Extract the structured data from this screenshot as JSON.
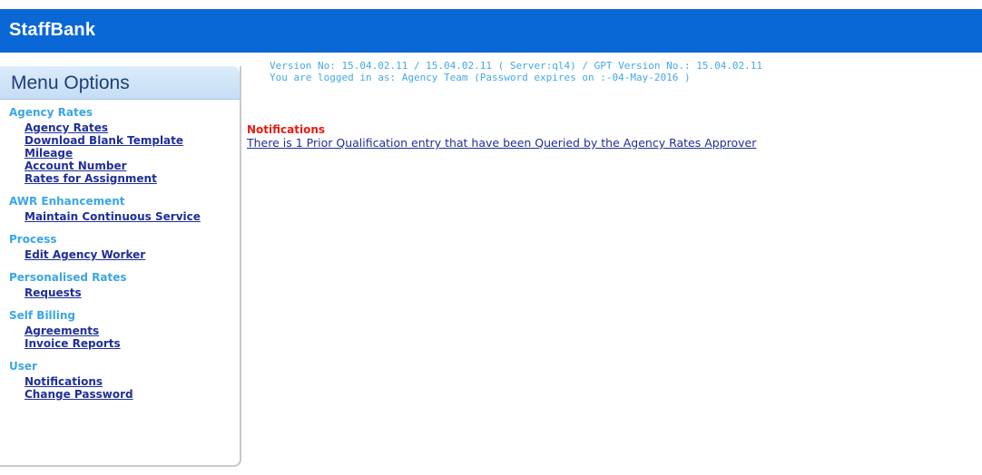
{
  "app": {
    "title": "StaffBank"
  },
  "sidebar": {
    "header": "Menu Options",
    "groups": [
      {
        "title": "Agency Rates",
        "items": [
          "Agency Rates",
          "Download Blank Template",
          "Mileage",
          "Account Number",
          "Rates for Assignment"
        ]
      },
      {
        "title": "AWR Enhancement",
        "items": [
          "Maintain Continuous Service"
        ]
      },
      {
        "title": "Process",
        "items": [
          "Edit Agency Worker"
        ]
      },
      {
        "title": "Personalised Rates",
        "items": [
          "Requests"
        ]
      },
      {
        "title": "Self Billing",
        "items": [
          "Agreements",
          "Invoice Reports"
        ]
      },
      {
        "title": "User",
        "items": [
          "Notifications",
          "Change Password"
        ]
      }
    ]
  },
  "info": {
    "version_line": "Version No: 15.04.02.11 / 15.04.02.11 ( Server:ql4) / GPT Version No.: 15.04.02.11",
    "login_line": "You are logged in as: Agency Team (Password expires on :-04-May-2016 )"
  },
  "notifications": {
    "title": "Notifications",
    "message": "There is 1 Prior Qualification entry that have been Queried by the Agency Rates Approver"
  },
  "colors": {
    "topbar": "#0a67d6",
    "group_title": "#3aa6e6",
    "link": "#1f2f99",
    "notification_title": "#e51b12",
    "info_text": "#45a8e6"
  }
}
